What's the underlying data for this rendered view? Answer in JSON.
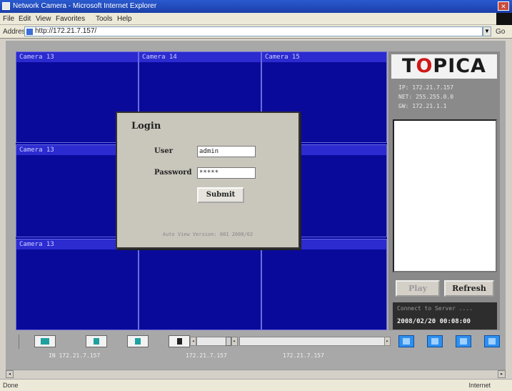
{
  "browser": {
    "title": "Network Camera - Microsoft Internet Explorer",
    "menu": [
      "File",
      "Edit",
      "View",
      "Favorites",
      "Tools",
      "Help"
    ],
    "address_label": "Address",
    "url": "http://172.21.7.157/",
    "go_label": "Go",
    "status_left": "Done",
    "status_zone": "Internet"
  },
  "cameras": [
    {
      "label": "Camera 13"
    },
    {
      "label": "Camera 14"
    },
    {
      "label": "Camera 15"
    },
    {
      "label": "Camera 13"
    },
    {
      "label": ""
    },
    {
      "label": ""
    },
    {
      "label": "Camera 13"
    },
    {
      "label": ""
    },
    {
      "label": ""
    }
  ],
  "side": {
    "logo_pre": "T",
    "logo_o": "O",
    "logo_post": "PICA",
    "info": [
      "IP: 172.21.7.157",
      "NET: 255.255.0.0",
      "GW: 172.21.1.1"
    ],
    "play_label": "Play",
    "refresh_label": "Refresh",
    "status_msg": "Connect to Server ....",
    "status_time": "2008/02/20 00:08:00"
  },
  "controls": {
    "labels": [
      "IN 172.21.7.157",
      "172.21.7.157",
      "172.21.7.157"
    ]
  },
  "login": {
    "title": "Login",
    "user_label": "User",
    "user_value": "admin",
    "password_label": "Password",
    "password_value": "*****",
    "submit_label": "Submit",
    "footer": "Auto View Version: 001 2008/02"
  },
  "colors": {
    "video_bg": "#0a0a9a",
    "caption_bg": "#2b2bd0",
    "control_blue": "#2e8ff0",
    "logo_accent": "#d01818"
  }
}
